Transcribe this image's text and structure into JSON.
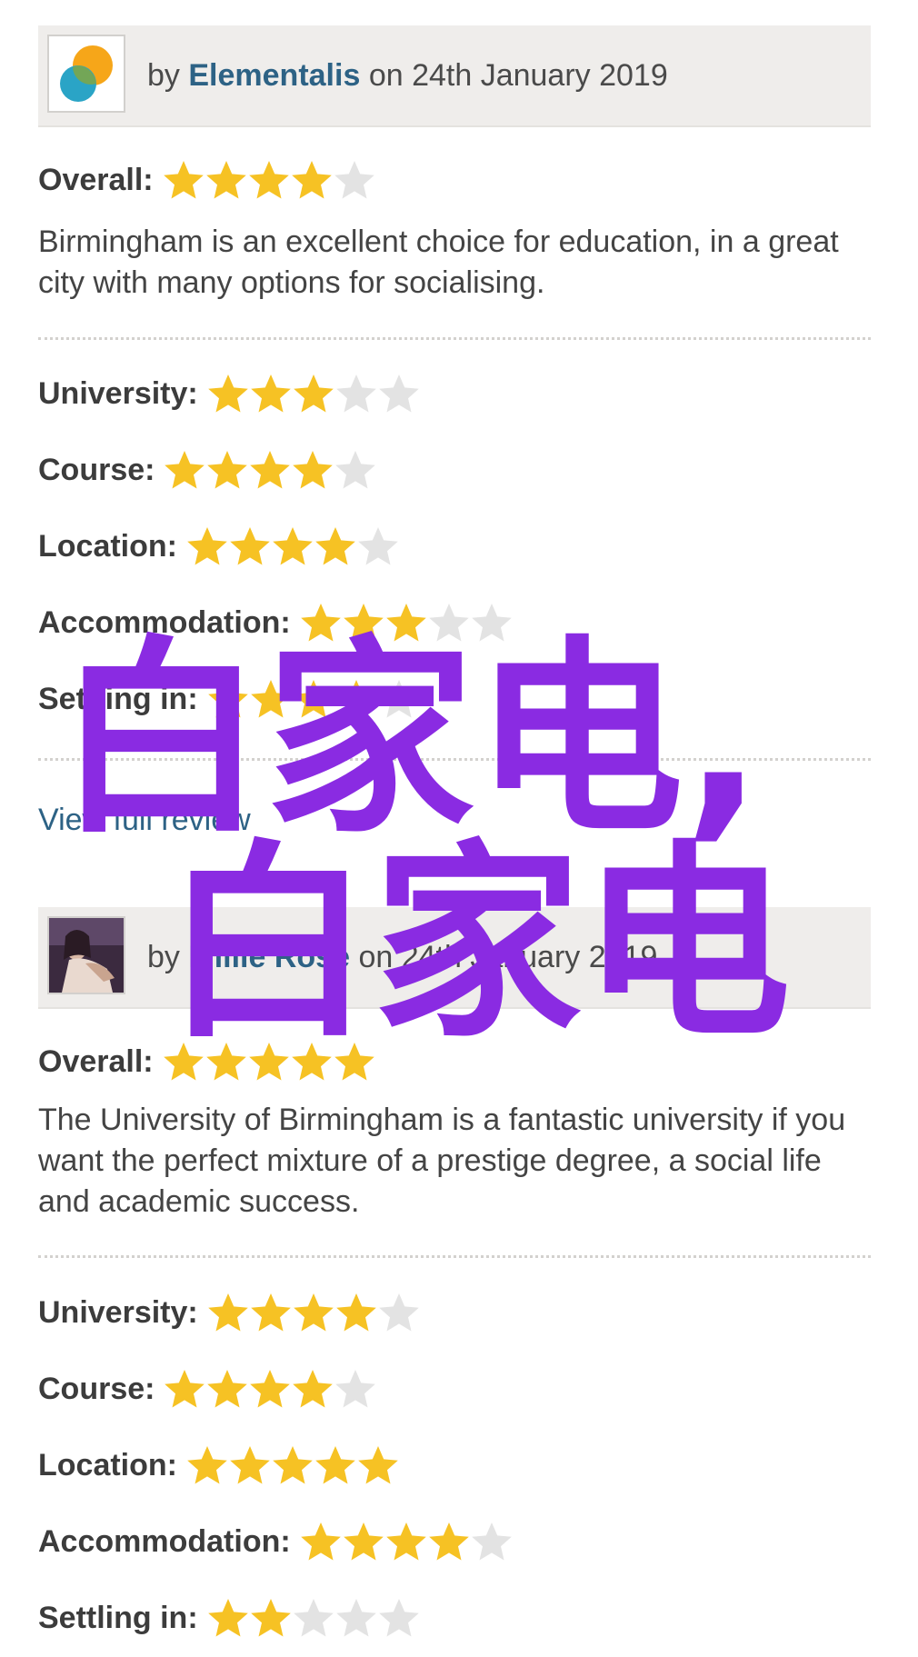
{
  "reviews": [
    {
      "by_prefix": "by",
      "author": "Elementalis",
      "date_text": "on 24th January 2019",
      "avatar_icon": "orange-blue-bubbles-avatar",
      "overall_label": "Overall:",
      "overall_stars": 4,
      "comment": "Birmingham is an excellent choice for education, in a great city with many options for socialising.",
      "ratings": [
        {
          "label": "University:",
          "stars": 3
        },
        {
          "label": "Course:",
          "stars": 4
        },
        {
          "label": "Location:",
          "stars": 4
        },
        {
          "label": "Accommodation:",
          "stars": 3
        },
        {
          "label": "Settling in:",
          "stars": 4
        }
      ],
      "view_link": "View full review"
    },
    {
      "by_prefix": "by",
      "author": "Millie Rose",
      "date_text": "on 24th January 2019",
      "avatar_icon": "photo-avatar",
      "overall_label": "Overall:",
      "overall_stars": 5,
      "comment": "The University of Birmingham is a fantastic university if you want the perfect mixture of a prestige degree, a social life and academic success.",
      "ratings": [
        {
          "label": "University:",
          "stars": 4
        },
        {
          "label": "Course:",
          "stars": 4
        },
        {
          "label": "Location:",
          "stars": 5
        },
        {
          "label": "Accommodation:",
          "stars": 4
        },
        {
          "label": "Settling in:",
          "stars": 2
        }
      ]
    }
  ],
  "max_stars": 5,
  "colors": {
    "star_filled": "#f6c224",
    "star_empty": "#e3e3e3",
    "link": "#2d6285",
    "watermark": "#8a2be2"
  },
  "watermark": {
    "line1": "白家电,",
    "line2": "白家电"
  }
}
